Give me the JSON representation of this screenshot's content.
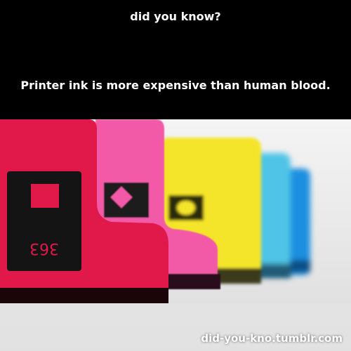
{
  "header": {
    "heading": "did you know?",
    "fact": "Printer ink is more expensive than human blood."
  },
  "photo": {
    "cartridge_label": "363",
    "cartridge_colors": [
      "#e0194a",
      "#f25aa8",
      "#f5e52a",
      "#4fc4e6",
      "#1f8fe0"
    ]
  },
  "footer": {
    "watermark": "did-you-kno.tumblr.com"
  }
}
